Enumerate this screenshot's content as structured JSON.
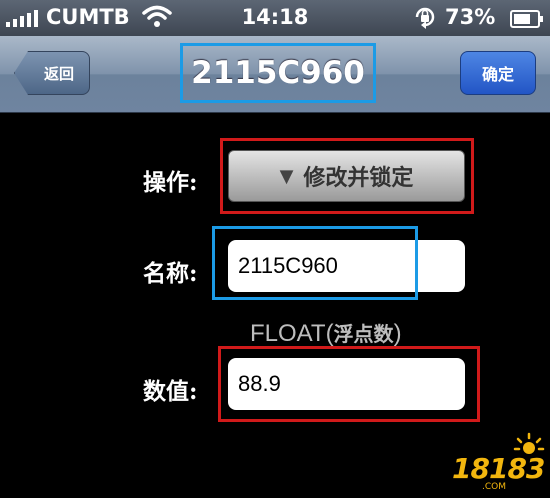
{
  "status_bar": {
    "carrier": "CUMTB",
    "time": "14:18",
    "battery_percent": "73%",
    "battery_level": 0.73,
    "icons": [
      "signal-icon",
      "wifi-icon",
      "rotation-lock-icon",
      "battery-icon"
    ]
  },
  "nav": {
    "back_label": "返回",
    "title": "2115C960",
    "confirm_label": "确定"
  },
  "form": {
    "operation_label": "操作:",
    "operation_value": "修改并锁定",
    "operation_icon": "dropdown-caret-icon",
    "name_label": "名称:",
    "name_value": "2115C960",
    "type_hint_prefix": "FLOAT(",
    "type_hint_cn": "浮点数",
    "type_hint_suffix": ")",
    "value_label": "数值:",
    "value_value": "88.9"
  },
  "watermark": {
    "text": "18183",
    "sub": ".COM"
  },
  "colors": {
    "highlight_red": "#d11a1a",
    "highlight_blue": "#1c9be6",
    "watermark": "#f2b60e"
  }
}
